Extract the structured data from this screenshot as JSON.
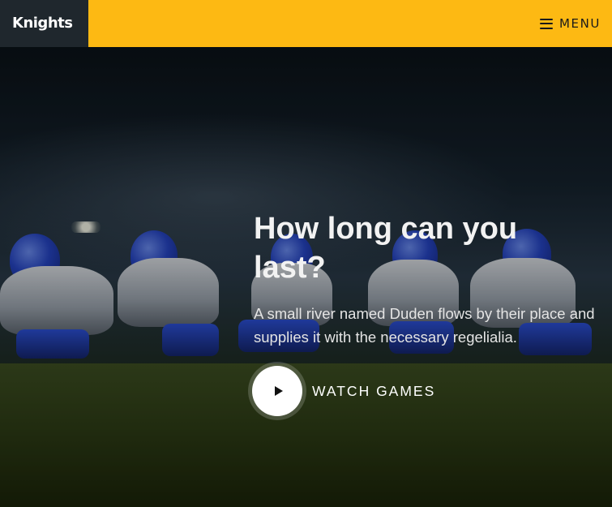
{
  "navbar": {
    "brand": "Knights",
    "menu_label": "MENU",
    "menu_icon": "hamburger-icon",
    "background_color": "#fdb913",
    "brand_background_color": "#1f272d"
  },
  "hero": {
    "title": "How long can you last?",
    "subtitle": "A small river named Duden flows by their place and supplies it with the necessary regelialia.",
    "cta_label": "WATCH GAMES",
    "cta_icon": "play-icon"
  }
}
